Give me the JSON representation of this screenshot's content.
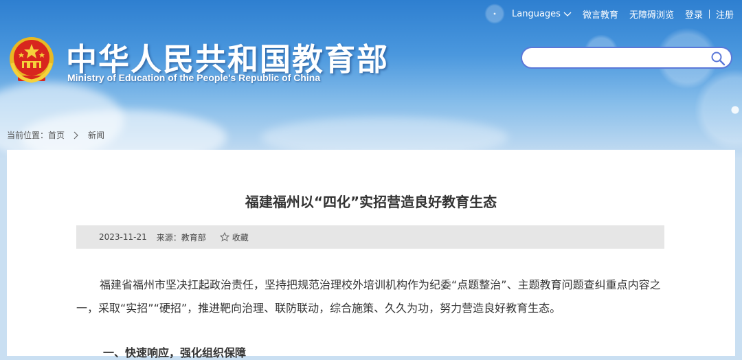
{
  "topnav": {
    "languages": "Languages",
    "weiyan": "微言教育",
    "accessible": "无障碍浏览",
    "login": "登录",
    "logout": "注册"
  },
  "header": {
    "title_cn": "中华人民共和国教育部",
    "title_en": "Ministry of Education of the People's Republic of China"
  },
  "search": {
    "placeholder": ""
  },
  "breadcrumb": {
    "label": "当前位置：",
    "home": "首页",
    "current": "新闻"
  },
  "article": {
    "title": "福建福州以“四化”实招营造良好教育生态",
    "date": "2023-11-21",
    "source": "来源：教育部",
    "favorite": "收藏",
    "paragraph": "福建省福州市坚决扛起政治责任，坚持把规范治理校外培训机构作为纪委“点题整治”、主题教育问题查纠重点内容之一，采取“实招”“硬招”，推进靶向治理、联防联动，综合施策、久久为功，努力营造良好教育生态。",
    "next_heading": "一、快速响应，强化组织保障"
  },
  "colors": {
    "accent": "#5b78d8",
    "header_blue": "#2e7fd0"
  }
}
